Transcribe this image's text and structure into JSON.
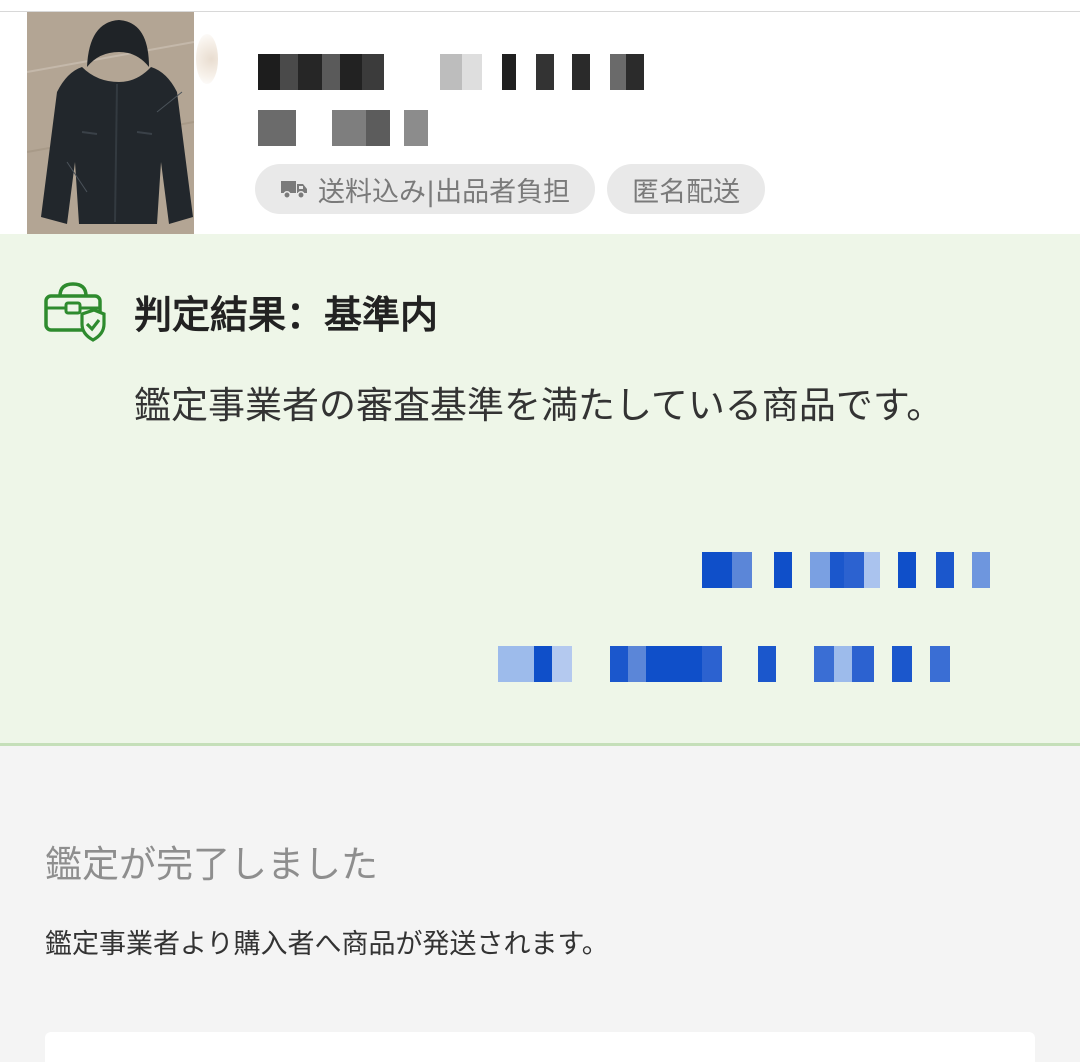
{
  "product": {
    "image_alt": "black hooded winter coat",
    "title_redacted": true,
    "price_redacted": true,
    "tags": [
      {
        "label": "送料込み|出品者負担",
        "icon": "truck-icon"
      },
      {
        "label": "匿名配送",
        "icon": ""
      }
    ]
  },
  "judgement": {
    "icon": "bag-shield-icon",
    "title": "判定結果：基準内",
    "description": "鑑定事業者の審査基準を満たしている商品です。",
    "links_redacted": true,
    "accent_color": "#2e8b2e"
  },
  "completion": {
    "title": "鑑定が完了しました",
    "description": "鑑定事業者より購入者へ商品が発送されます。"
  },
  "colors": {
    "panel_background": "#eef6e8",
    "section_background": "#f4f4f4",
    "link_blue": "#1757d6"
  }
}
